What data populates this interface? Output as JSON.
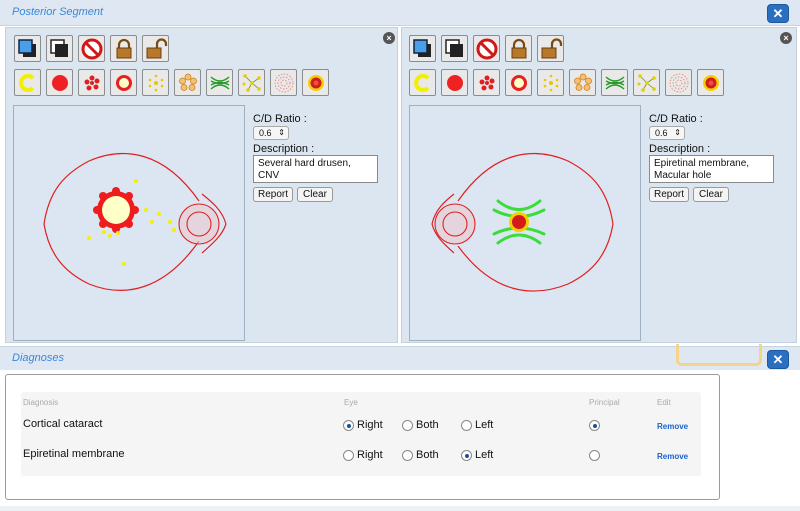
{
  "header": {
    "title": "Posterior Segment",
    "close_icon": "x-icon"
  },
  "panels": [
    {
      "side": "right-eye",
      "cd_label": "C/D Ratio :",
      "cd_value": "0.6",
      "description_label": "Description :",
      "description": "Several hard drusen, CNV",
      "report_label": "Report",
      "clear_label": "Clear"
    },
    {
      "side": "left-eye",
      "cd_label": "C/D Ratio :",
      "cd_value": "0.6",
      "description_label": "Description :",
      "description": "Epiretinal membrane, Macular hole",
      "report_label": "Report",
      "clear_label": "Clear"
    }
  ],
  "toolbar_row1_icons": [
    "move-to-front-icon",
    "move-to-back-icon",
    "delete-icon",
    "lock-icon",
    "unlock-icon"
  ],
  "toolbar_row2_icons": [
    "cotton-wool-spot-icon",
    "hemorrhage-icon",
    "microaneurysm-cluster-icon",
    "cnv-icon",
    "drusen-icon",
    "laser-spots-icon",
    "epiretinal-membrane-icon",
    "hard-exudates-icon",
    "prp-icon",
    "macular-hole-icon"
  ],
  "diagnoses": {
    "title": "Diagnoses",
    "headers": {
      "diagnosis": "Diagnosis",
      "eye": "Eye",
      "principal": "Principal",
      "edit": "Edit"
    },
    "eye_options": [
      "Right",
      "Both",
      "Left"
    ],
    "rows": [
      {
        "name": "Cortical cataract",
        "eye": "Right",
        "principal": true,
        "remove_label": "Remove"
      },
      {
        "name": "Epiretinal membrane",
        "eye": "Left",
        "principal": false,
        "remove_label": "Remove"
      }
    ]
  },
  "colors": {
    "accent": "#3a87d8",
    "button_blue": "#2a6fc0",
    "vessel_red": "#e02020",
    "drusen_yellow": "#f5f000",
    "membrane_green": "#3cdc3c"
  }
}
